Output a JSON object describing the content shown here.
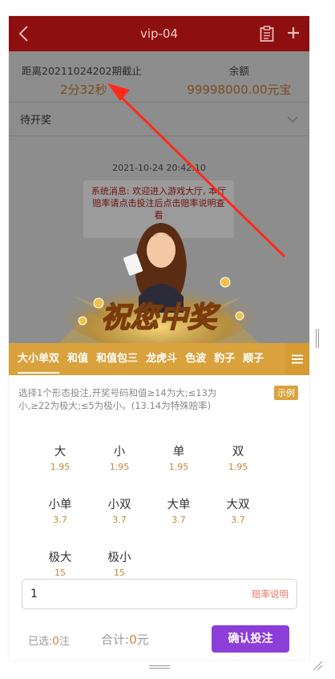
{
  "header": {
    "title": "vip-04",
    "back_icon": "chevron-left-icon",
    "clipboard_icon": "clipboard-icon",
    "add_icon": "plus-icon"
  },
  "info": {
    "period_label": "距离20211024202期截止",
    "countdown": "2分32秒",
    "balance_label": "余额",
    "balance_value": "99998000.00元宝"
  },
  "pending": {
    "label": "待开奖"
  },
  "chat": {
    "timestamp": "2021-10-24 20:42:10",
    "system_message": "系统消息: 欢迎进入游戏大厅, 本厅赔率请点击投注后点击赔率说明查看"
  },
  "banner": {
    "text": "祝您中奖"
  },
  "tabs": [
    "大小单双",
    "和值",
    "和值包三",
    "龙虎斗",
    "色波",
    "豹子",
    "顺子"
  ],
  "active_tab": 0,
  "description": "选择1个形态投注,开奖号码和值≥14为大;≤13为小,≥22为极大;≤5为极小。(13.14为特殊赔率)",
  "example_label": "示例",
  "bets": [
    {
      "name": "大",
      "odds": "1.95"
    },
    {
      "name": "小",
      "odds": "1.95"
    },
    {
      "name": "单",
      "odds": "1.95"
    },
    {
      "name": "双",
      "odds": "1.95"
    },
    {
      "name": "小单",
      "odds": "3.7"
    },
    {
      "name": "小双",
      "odds": "3.7"
    },
    {
      "name": "大单",
      "odds": "3.7"
    },
    {
      "name": "大双",
      "odds": "3.7"
    },
    {
      "name": "极大",
      "odds": "15"
    },
    {
      "name": "极小",
      "odds": "15"
    }
  ],
  "amount": {
    "value": "1",
    "odds_link": "赔率说明"
  },
  "footer": {
    "selected_label": "已选:",
    "selected_count": "0",
    "selected_unit": "注",
    "total_label": "合计:",
    "total_value": "0",
    "total_unit": "元",
    "confirm_label": "确认投注"
  },
  "colors": {
    "header": "#8e0f0f",
    "tab_bar": "#d9a23d",
    "confirm": "#8d3ed9",
    "odds": "#c8863a",
    "arrow": "#ff2a1a"
  }
}
